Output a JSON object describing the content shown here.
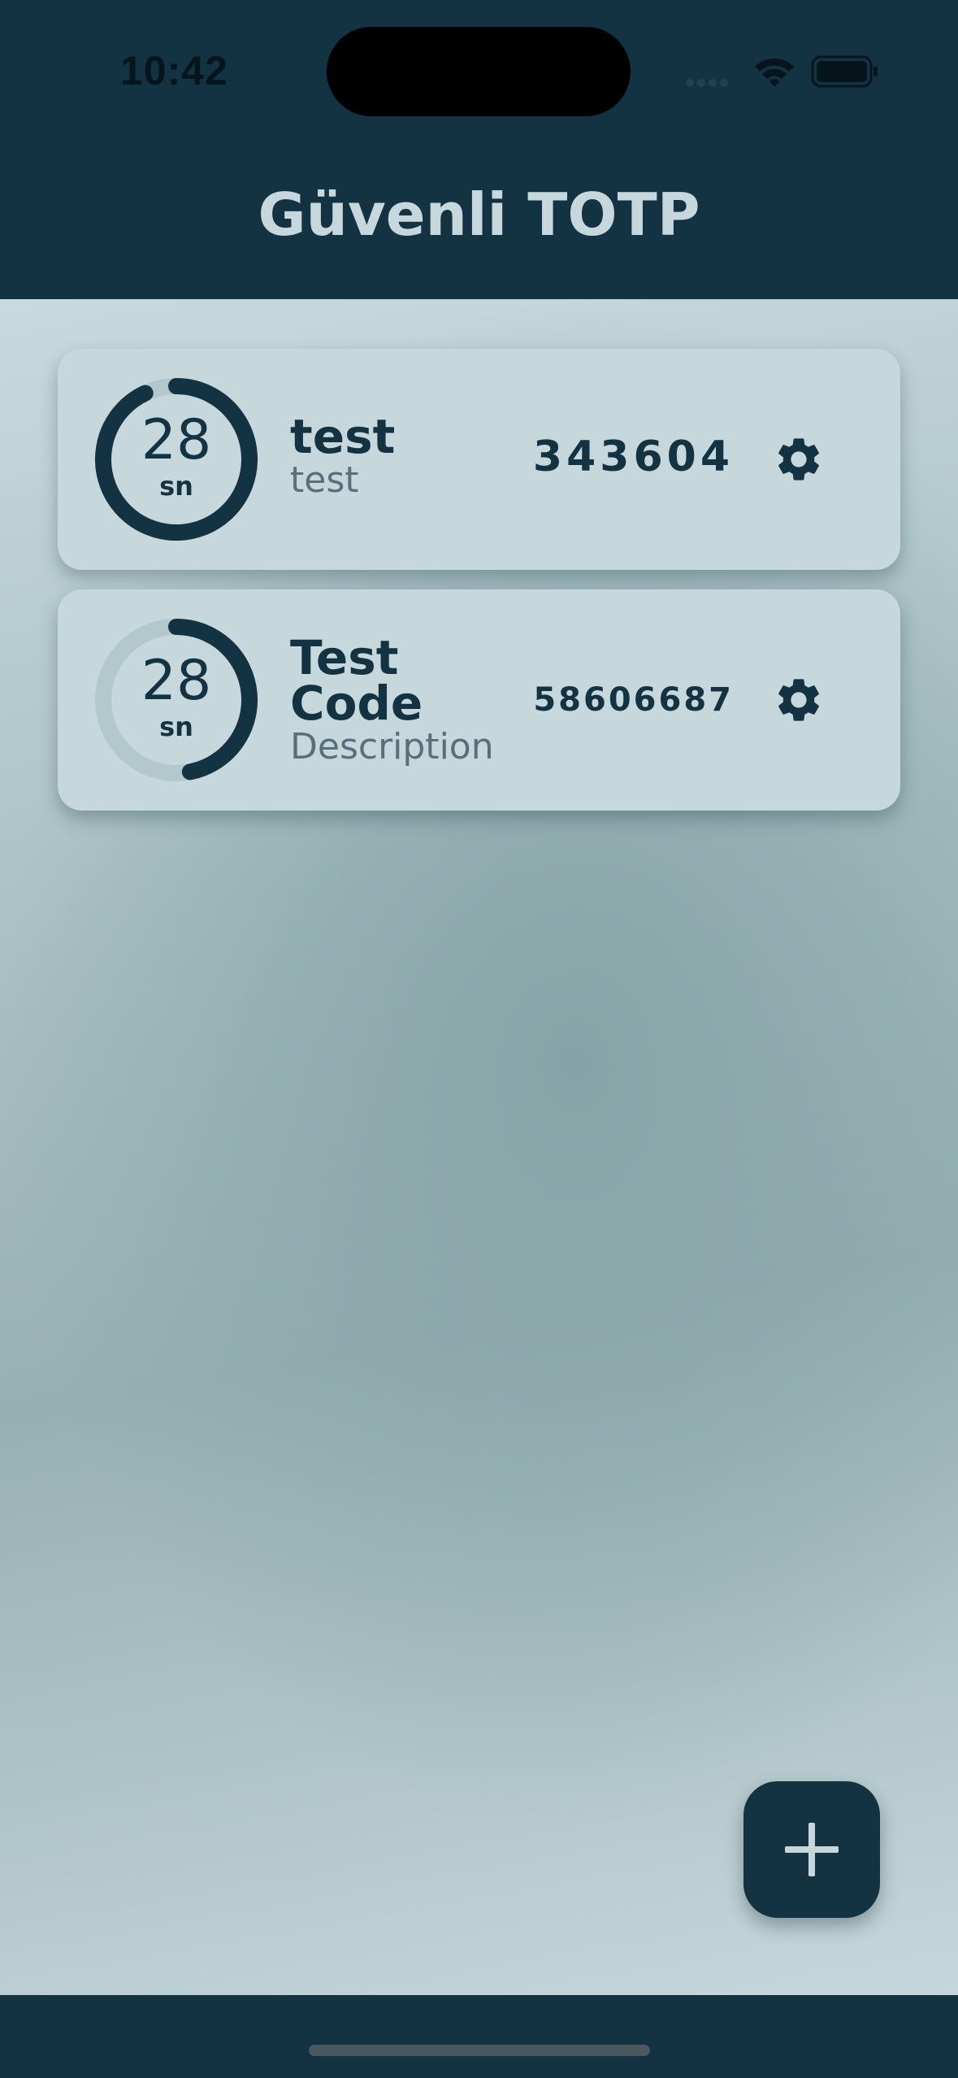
{
  "status_bar": {
    "time": "10:42"
  },
  "header": {
    "title": "Güvenli TOTP"
  },
  "colors": {
    "primary": "#133343",
    "card": "#c6d8dc",
    "muted_text": "#587079"
  },
  "accounts": [
    {
      "name": "test",
      "description": "test",
      "code": "343604",
      "seconds": "28",
      "unit": "sn",
      "progress": 0.93,
      "icon": "gear-icon"
    },
    {
      "name": "Test Code",
      "description": "Description",
      "code": "58606687",
      "seconds": "28",
      "unit": "sn",
      "progress": 0.47,
      "icon": "gear-icon"
    }
  ],
  "fab": {
    "icon": "plus-icon"
  }
}
